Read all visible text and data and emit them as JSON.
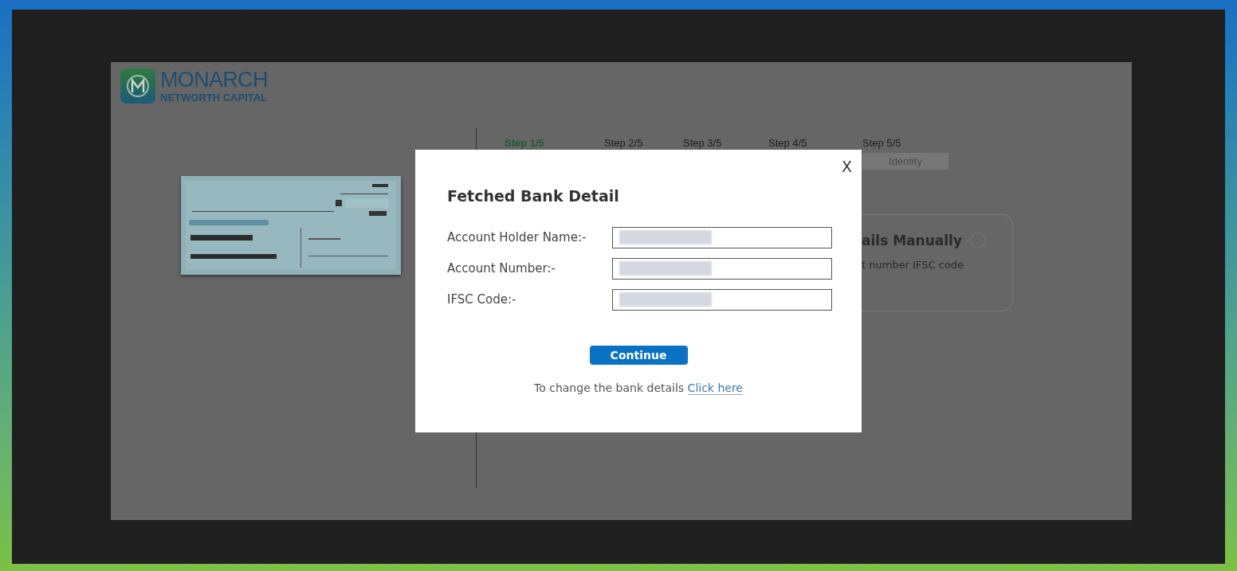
{
  "brand": {
    "name": "MONARCH",
    "tagline": "NETWORTH CAPITAL"
  },
  "steps": [
    {
      "label": "Step 1/5",
      "selected": true
    },
    {
      "label": "Step 2/5",
      "selected": false
    },
    {
      "label": "Step 3/5",
      "selected": false
    },
    {
      "label": "Step 4/5",
      "selected": false
    },
    {
      "label": "Step 5/5",
      "selected": false
    }
  ],
  "step_tabs": [
    {
      "label": "Identity"
    }
  ],
  "option_card": {
    "title": "ails Manually",
    "subtitle": "t number IFSC code",
    "selected": false
  },
  "dialog": {
    "title": "Fetched Bank Detail",
    "close": "X",
    "fields": [
      {
        "label": "Account Holder Name:-"
      },
      {
        "label": "Account Number:-"
      },
      {
        "label": "IFSC Code:-"
      }
    ],
    "continue": "Continue",
    "footer": {
      "text": "To change the bank details",
      "link": "Click here"
    }
  }
}
